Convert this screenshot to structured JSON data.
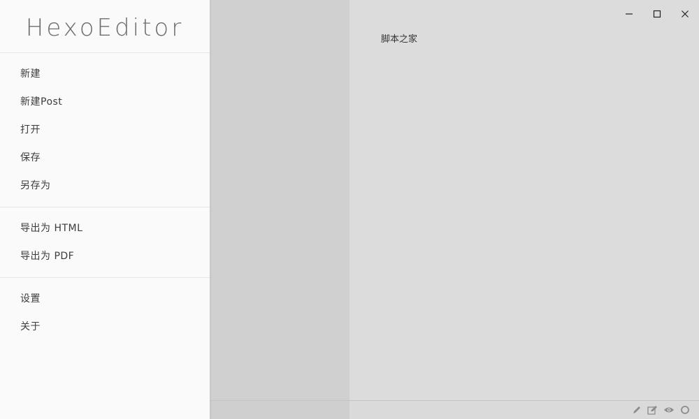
{
  "app": {
    "title": "HexoEditor"
  },
  "menu": {
    "groups": [
      {
        "items": [
          {
            "label": "新建"
          },
          {
            "label": "新建Post"
          },
          {
            "label": "打开"
          },
          {
            "label": "保存"
          },
          {
            "label": "另存为"
          }
        ]
      },
      {
        "items": [
          {
            "label": "导出为 HTML"
          },
          {
            "label": "导出为 PDF"
          }
        ]
      },
      {
        "items": [
          {
            "label": "设置"
          },
          {
            "label": "关于"
          }
        ]
      }
    ]
  },
  "preview": {
    "text": "脚本之家"
  },
  "window_controls": {
    "icons": [
      "minimize-icon",
      "maximize-icon",
      "close-icon"
    ]
  },
  "statusbar": {
    "icons": [
      "pencil-icon",
      "edit-icon",
      "eye-icon",
      "circle-icon"
    ]
  },
  "colors": {
    "drawer_bg": "#fafafa",
    "editor_bg": "#d0d0d0",
    "preview_bg": "#dcdcdc",
    "text": "#3c3c3c",
    "icon": "#8c8c8c"
  }
}
